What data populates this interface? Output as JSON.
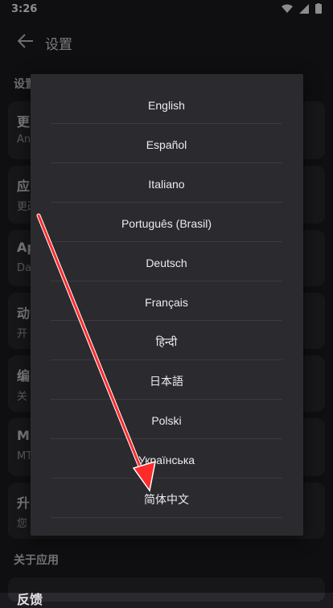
{
  "status": {
    "time": "3:26"
  },
  "appbar": {
    "title": "设置"
  },
  "background": {
    "section1": "设置",
    "cards": [
      {
        "title": "更",
        "sub": "An"
      },
      {
        "title": "应",
        "sub": "更改"
      },
      {
        "title": "Ap",
        "sub": "Da"
      },
      {
        "title": "动",
        "sub": "开"
      },
      {
        "title": "编",
        "sub": "关"
      },
      {
        "title": "M",
        "sub": "MT"
      },
      {
        "title": "升",
        "sub": "您"
      }
    ],
    "section2": "关于应用",
    "last_card": "反馈"
  },
  "dialog": {
    "options": [
      "English",
      "Español",
      "Italiano",
      "Português (Brasil)",
      "Deutsch",
      "Français",
      "हिन्दी",
      "日本語",
      "Polski",
      "Українська",
      "简体中文"
    ]
  },
  "annotation": {
    "arrow_color": "#ff2a2a"
  }
}
